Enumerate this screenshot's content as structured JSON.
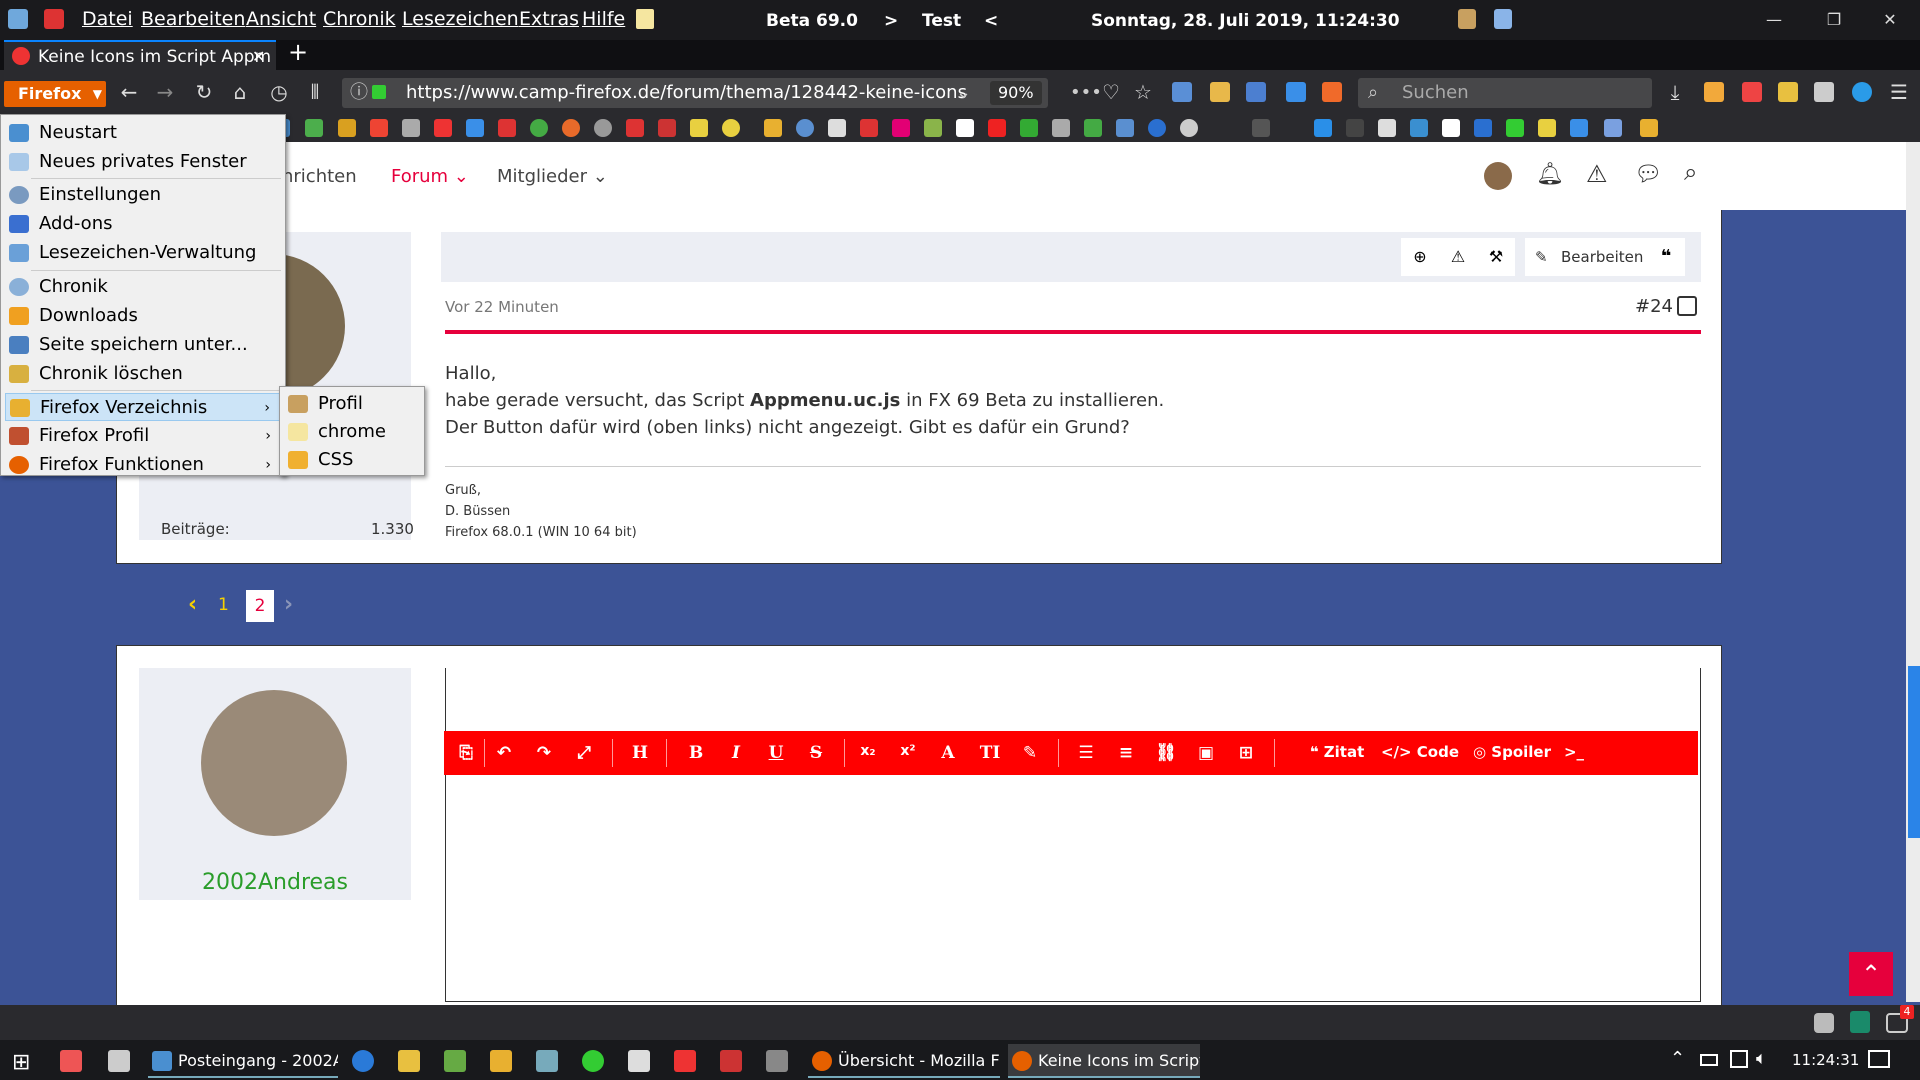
{
  "menubar": {
    "items": [
      "Datei",
      "Bearbeiten",
      "Ansicht",
      "Chronik",
      "Lesezeichen",
      "Extras",
      "Hilfe"
    ],
    "title_center": "Beta 69.0",
    "title_gt": ">",
    "title_test": "Test",
    "title_lt": "<",
    "datetime": "Sonntag, 28. Juli 2019, 11:24:30"
  },
  "tab": {
    "title": "Keine Icons im Script Appm",
    "close": "✕",
    "new": "+"
  },
  "nav": {
    "firefox_label": "Firefox",
    "url": "https://www.camp-firefox.de/forum/thema/128442-keine-icons",
    "zoom": "90%",
    "search_placeholder": "Suchen"
  },
  "site": {
    "nav_items": [
      "hrichten",
      "Forum",
      "Mitglieder"
    ],
    "active_nav": "Forum"
  },
  "post": {
    "edit_label": "Bearbeiten",
    "time": "Vor 22 Minuten",
    "number": "#24",
    "greeting": "Hallo,",
    "line2_pre": "habe gerade versucht, das Script ",
    "line2_bold": "Appmenu.uc.js",
    "line2_post": " in FX 69 Beta zu installieren.",
    "line3": "Der Button dafür wird (oben links) nicht angezeigt. Gibt es dafür ein Grund?",
    "sig1": "Gruß,",
    "sig2": "D. Büssen",
    "sig3": "Firefox 68.0.1 (WIN 10 64 bit)",
    "posts_label": "Beiträge:",
    "posts_count": "1.330"
  },
  "pagination": {
    "pages": [
      "1",
      "2"
    ],
    "current": "2"
  },
  "reply": {
    "username": "2002Andreas",
    "username_color": "#2a9d2a",
    "toolbar": [
      "Zitat",
      "Code",
      "Spoiler"
    ]
  },
  "menu": {
    "items": [
      "Neustart",
      "Neues privates Fenster",
      "Einstellungen",
      "Add-ons",
      "Lesezeichen-Verwaltung",
      "Chronik",
      "Downloads",
      "Seite speichern unter...",
      "Chronik löschen",
      "Firefox Verzeichnis",
      "Firefox Profil",
      "Firefox Funktionen"
    ],
    "submenu": [
      "Profil",
      "chrome",
      "CSS"
    ],
    "arrow": "›"
  },
  "taskbar": {
    "tasks": [
      "Posteingang - 2002An...",
      "Übersicht - Mozilla Fir...",
      "Keine Icons im Script ..."
    ],
    "clock": "11:24:31",
    "notify_count": "4"
  },
  "colors": {
    "accent": "#e6003c",
    "firefox_orange": "#e66000",
    "editor_red": "#ff0000",
    "page_bg": "#3c5396"
  }
}
